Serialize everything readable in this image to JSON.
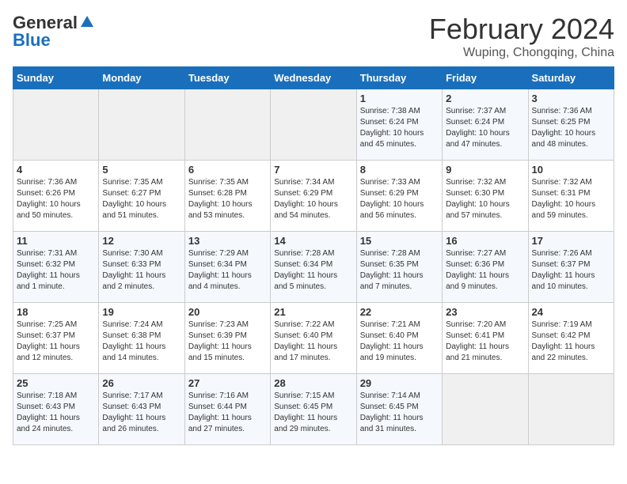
{
  "logo": {
    "general": "General",
    "blue": "Blue"
  },
  "title": "February 2024",
  "location": "Wuping, Chongqing, China",
  "days_of_week": [
    "Sunday",
    "Monday",
    "Tuesday",
    "Wednesday",
    "Thursday",
    "Friday",
    "Saturday"
  ],
  "weeks": [
    [
      {
        "day": null,
        "info": null
      },
      {
        "day": null,
        "info": null
      },
      {
        "day": null,
        "info": null
      },
      {
        "day": null,
        "info": null
      },
      {
        "day": "1",
        "info": "Sunrise: 7:38 AM\nSunset: 6:24 PM\nDaylight: 10 hours\nand 45 minutes."
      },
      {
        "day": "2",
        "info": "Sunrise: 7:37 AM\nSunset: 6:24 PM\nDaylight: 10 hours\nand 47 minutes."
      },
      {
        "day": "3",
        "info": "Sunrise: 7:36 AM\nSunset: 6:25 PM\nDaylight: 10 hours\nand 48 minutes."
      }
    ],
    [
      {
        "day": "4",
        "info": "Sunrise: 7:36 AM\nSunset: 6:26 PM\nDaylight: 10 hours\nand 50 minutes."
      },
      {
        "day": "5",
        "info": "Sunrise: 7:35 AM\nSunset: 6:27 PM\nDaylight: 10 hours\nand 51 minutes."
      },
      {
        "day": "6",
        "info": "Sunrise: 7:35 AM\nSunset: 6:28 PM\nDaylight: 10 hours\nand 53 minutes."
      },
      {
        "day": "7",
        "info": "Sunrise: 7:34 AM\nSunset: 6:29 PM\nDaylight: 10 hours\nand 54 minutes."
      },
      {
        "day": "8",
        "info": "Sunrise: 7:33 AM\nSunset: 6:29 PM\nDaylight: 10 hours\nand 56 minutes."
      },
      {
        "day": "9",
        "info": "Sunrise: 7:32 AM\nSunset: 6:30 PM\nDaylight: 10 hours\nand 57 minutes."
      },
      {
        "day": "10",
        "info": "Sunrise: 7:32 AM\nSunset: 6:31 PM\nDaylight: 10 hours\nand 59 minutes."
      }
    ],
    [
      {
        "day": "11",
        "info": "Sunrise: 7:31 AM\nSunset: 6:32 PM\nDaylight: 11 hours\nand 1 minute."
      },
      {
        "day": "12",
        "info": "Sunrise: 7:30 AM\nSunset: 6:33 PM\nDaylight: 11 hours\nand 2 minutes."
      },
      {
        "day": "13",
        "info": "Sunrise: 7:29 AM\nSunset: 6:34 PM\nDaylight: 11 hours\nand 4 minutes."
      },
      {
        "day": "14",
        "info": "Sunrise: 7:28 AM\nSunset: 6:34 PM\nDaylight: 11 hours\nand 5 minutes."
      },
      {
        "day": "15",
        "info": "Sunrise: 7:28 AM\nSunset: 6:35 PM\nDaylight: 11 hours\nand 7 minutes."
      },
      {
        "day": "16",
        "info": "Sunrise: 7:27 AM\nSunset: 6:36 PM\nDaylight: 11 hours\nand 9 minutes."
      },
      {
        "day": "17",
        "info": "Sunrise: 7:26 AM\nSunset: 6:37 PM\nDaylight: 11 hours\nand 10 minutes."
      }
    ],
    [
      {
        "day": "18",
        "info": "Sunrise: 7:25 AM\nSunset: 6:37 PM\nDaylight: 11 hours\nand 12 minutes."
      },
      {
        "day": "19",
        "info": "Sunrise: 7:24 AM\nSunset: 6:38 PM\nDaylight: 11 hours\nand 14 minutes."
      },
      {
        "day": "20",
        "info": "Sunrise: 7:23 AM\nSunset: 6:39 PM\nDaylight: 11 hours\nand 15 minutes."
      },
      {
        "day": "21",
        "info": "Sunrise: 7:22 AM\nSunset: 6:40 PM\nDaylight: 11 hours\nand 17 minutes."
      },
      {
        "day": "22",
        "info": "Sunrise: 7:21 AM\nSunset: 6:40 PM\nDaylight: 11 hours\nand 19 minutes."
      },
      {
        "day": "23",
        "info": "Sunrise: 7:20 AM\nSunset: 6:41 PM\nDaylight: 11 hours\nand 21 minutes."
      },
      {
        "day": "24",
        "info": "Sunrise: 7:19 AM\nSunset: 6:42 PM\nDaylight: 11 hours\nand 22 minutes."
      }
    ],
    [
      {
        "day": "25",
        "info": "Sunrise: 7:18 AM\nSunset: 6:43 PM\nDaylight: 11 hours\nand 24 minutes."
      },
      {
        "day": "26",
        "info": "Sunrise: 7:17 AM\nSunset: 6:43 PM\nDaylight: 11 hours\nand 26 minutes."
      },
      {
        "day": "27",
        "info": "Sunrise: 7:16 AM\nSunset: 6:44 PM\nDaylight: 11 hours\nand 27 minutes."
      },
      {
        "day": "28",
        "info": "Sunrise: 7:15 AM\nSunset: 6:45 PM\nDaylight: 11 hours\nand 29 minutes."
      },
      {
        "day": "29",
        "info": "Sunrise: 7:14 AM\nSunset: 6:45 PM\nDaylight: 11 hours\nand 31 minutes."
      },
      {
        "day": null,
        "info": null
      },
      {
        "day": null,
        "info": null
      }
    ]
  ]
}
